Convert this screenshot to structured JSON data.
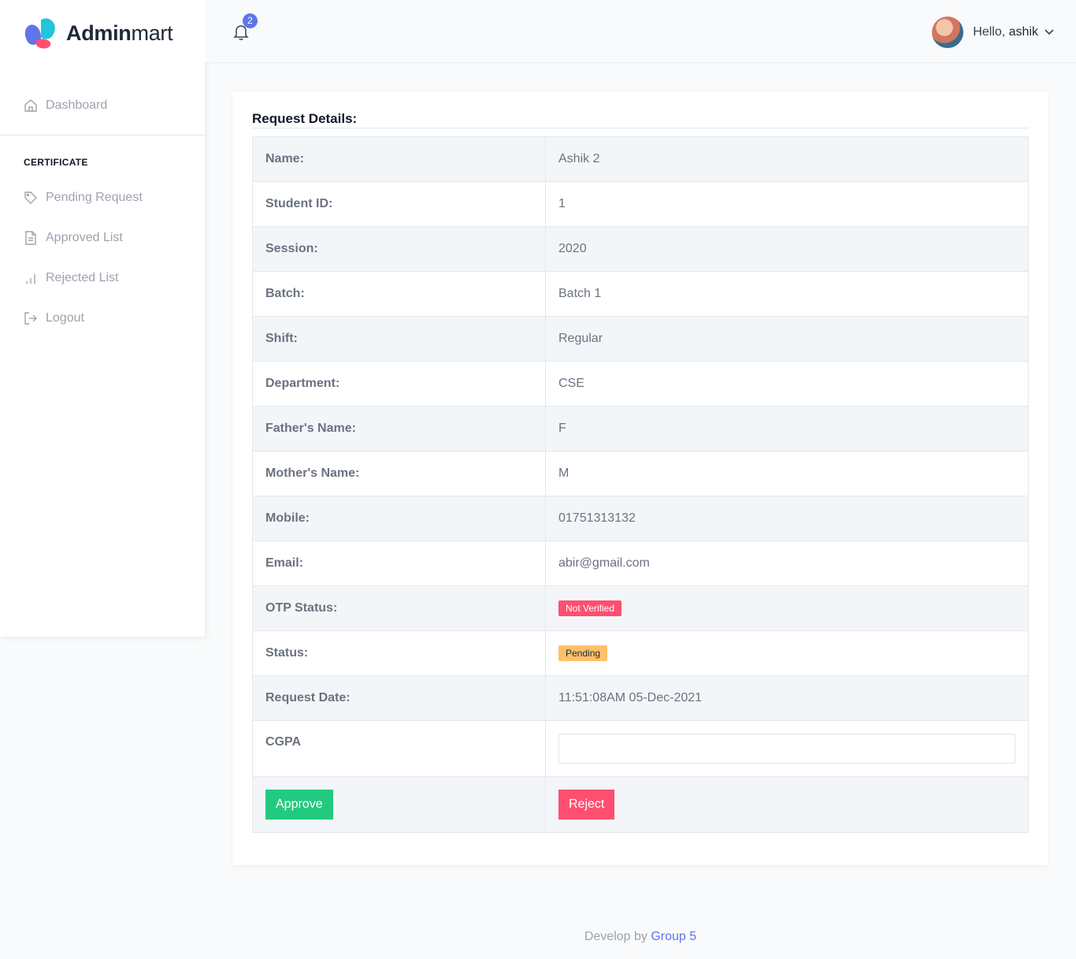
{
  "brand": {
    "bold": "Admin",
    "light": "mart"
  },
  "sidebar": {
    "dashboard": "Dashboard",
    "section": "CERTIFICATE",
    "items": [
      {
        "label": "Pending Request",
        "icon": "tag-icon"
      },
      {
        "label": "Approved List",
        "icon": "file-icon"
      },
      {
        "label": "Rejected List",
        "icon": "bar-chart-icon"
      },
      {
        "label": "Logout",
        "icon": "logout-icon"
      }
    ]
  },
  "topbar": {
    "notification_count": "2",
    "greeting": "Hello,",
    "username": "ashik"
  },
  "card": {
    "title": "Request Details:",
    "rows": [
      {
        "label": "Name:",
        "value": "Ashik 2"
      },
      {
        "label": "Student ID:",
        "value": "1"
      },
      {
        "label": "Session:",
        "value": "2020"
      },
      {
        "label": "Batch:",
        "value": "Batch 1"
      },
      {
        "label": "Shift:",
        "value": "Regular"
      },
      {
        "label": "Department:",
        "value": "CSE"
      },
      {
        "label": "Father's Name:",
        "value": "F"
      },
      {
        "label": "Mother's Name:",
        "value": "M"
      },
      {
        "label": "Mobile:",
        "value": "01751313132"
      },
      {
        "label": "Email:",
        "value": "abir@gmail.com"
      },
      {
        "label": "OTP Status:",
        "value": "Not Verified"
      },
      {
        "label": "Status:",
        "value": "Pending"
      },
      {
        "label": "Request Date:",
        "value": "11:51:08AM 05-Dec-2021"
      }
    ],
    "cgpa_label": "CGPA",
    "cgpa_value": "",
    "approve_label": "Approve",
    "reject_label": "Reject"
  },
  "colors": {
    "accent": "#5f76e8",
    "approve": "#22ca80",
    "reject": "#ff4f70",
    "pending": "#fdc16a"
  },
  "footer": {
    "prefix": "Develop by",
    "link": "Group 5"
  }
}
